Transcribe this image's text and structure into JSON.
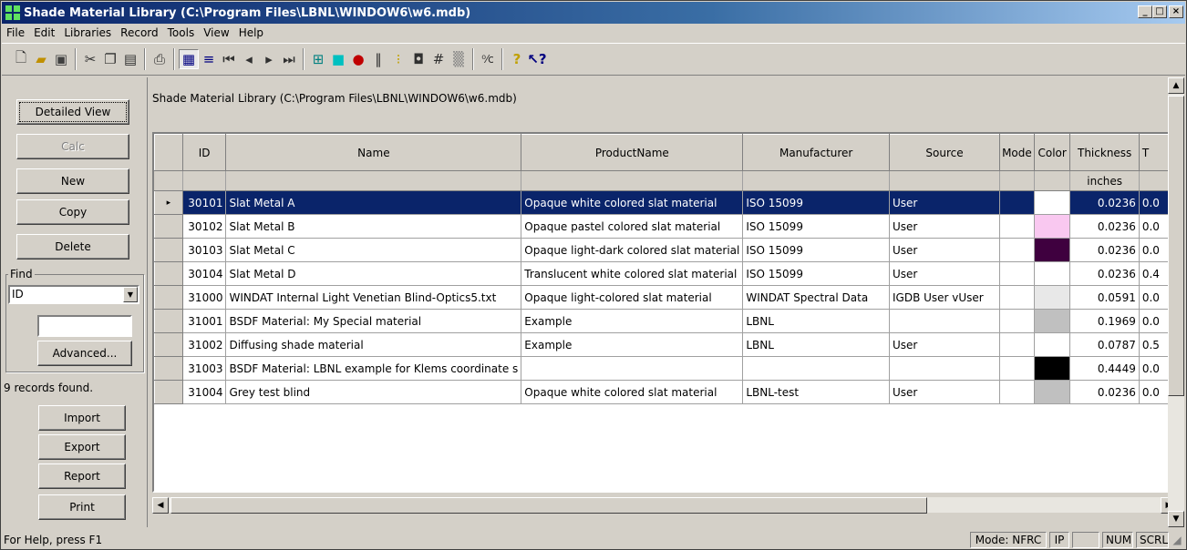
{
  "window": {
    "title": "Shade Material Library (C:\\Program Files\\LBNL\\WINDOW6\\w6.mdb)",
    "minimize": "_",
    "maximize": "□",
    "close": "×"
  },
  "menu": [
    "File",
    "Edit",
    "Libraries",
    "Record",
    "Tools",
    "View",
    "Help"
  ],
  "toolbar_icons": [
    "new-file-icon",
    "open-folder-icon",
    "save-icon",
    "cut-icon",
    "copy-icon",
    "paste-icon",
    "print-icon",
    "grid-view-icon",
    "list-view-icon",
    "first-record-icon",
    "prev-record-icon",
    "next-record-icon",
    "last-record-icon",
    "grid-icon",
    "cyan-square-icon",
    "red-balloon-icon",
    "bars-icon",
    "bulb-icon",
    "frame-icon",
    "hash-icon",
    "gradient-icon",
    "calc-icon",
    "help-icon",
    "whats-this-icon"
  ],
  "left_panel": {
    "detailed_view": "Detailed View",
    "calc": "Calc",
    "new": "New",
    "copy": "Copy",
    "delete": "Delete",
    "find_label": "Find",
    "find_field": "ID",
    "find_value": "",
    "advanced": "Advanced...",
    "records_found": "9 records found.",
    "import": "Import",
    "export": "Export",
    "report": "Report",
    "print": "Print"
  },
  "library_path": "Shade Material Library (C:\\Program Files\\LBNL\\WINDOW6\\w6.mdb)",
  "table": {
    "columns": [
      "ID",
      "Name",
      "ProductName",
      "Manufacturer",
      "Source",
      "Mode",
      "Color",
      "Thickness",
      "T"
    ],
    "units": [
      "",
      "",
      "",
      "",
      "",
      "",
      "",
      "inches",
      ""
    ],
    "rows": [
      {
        "marker": "▸",
        "id": "30101",
        "name": "Slat Metal A",
        "product": "Opaque white colored slat material",
        "manufacturer": "ISO 15099",
        "source": "User",
        "mode": "",
        "color": "#ffffff",
        "thickness": "0.0236",
        "t": "0.0"
      },
      {
        "marker": "",
        "id": "30102",
        "name": "Slat Metal B",
        "product": "Opaque pastel colored slat material",
        "manufacturer": "ISO 15099",
        "source": "User",
        "mode": "",
        "color": "#f9c8f0",
        "thickness": "0.0236",
        "t": "0.0"
      },
      {
        "marker": "",
        "id": "30103",
        "name": "Slat Metal C",
        "product": "Opaque light-dark colored slat material",
        "manufacturer": "ISO 15099",
        "source": "User",
        "mode": "",
        "color": "#3f003f",
        "thickness": "0.0236",
        "t": "0.0"
      },
      {
        "marker": "",
        "id": "30104",
        "name": "Slat Metal D",
        "product": "Translucent white colored slat material",
        "manufacturer": "ISO 15099",
        "source": "User",
        "mode": "",
        "color": "#ffffff",
        "thickness": "0.0236",
        "t": "0.4"
      },
      {
        "marker": "",
        "id": "31000",
        "name": "WINDAT Internal Light Venetian Blind-Optics5.txt",
        "product": "Opaque light-colored slat material",
        "manufacturer": "WINDAT Spectral Data",
        "source": "IGDB User vUser",
        "mode": "",
        "color": "#e8e8e8",
        "thickness": "0.0591",
        "t": "0.0"
      },
      {
        "marker": "",
        "id": "31001",
        "name": "BSDF Material: My Special material",
        "product": "Example",
        "manufacturer": "LBNL",
        "source": "",
        "mode": "",
        "color": "#c0c0c0",
        "thickness": "0.1969",
        "t": "0.0"
      },
      {
        "marker": "",
        "id": "31002",
        "name": "Diffusing shade material",
        "product": "Example",
        "manufacturer": "LBNL",
        "source": "User",
        "mode": "",
        "color": "#ffffff",
        "thickness": "0.0787",
        "t": "0.5"
      },
      {
        "marker": "",
        "id": "31003",
        "name": "BSDF Material: LBNL example for Klems coordinate s",
        "product": "",
        "manufacturer": "",
        "source": "",
        "mode": "",
        "color": "#000000",
        "thickness": "0.4449",
        "t": "0.0"
      },
      {
        "marker": "",
        "id": "31004",
        "name": "Grey test blind",
        "product": "Opaque white colored slat material",
        "manufacturer": "LBNL-test",
        "source": "User",
        "mode": "",
        "color": "#c0c0c0",
        "thickness": "0.0236",
        "t": "0.0"
      }
    ]
  },
  "status": {
    "help": "For Help, press F1",
    "mode": "Mode: NFRC",
    "ip": "IP",
    "blank": "",
    "num": "NUM",
    "scrl": "SCRL"
  }
}
